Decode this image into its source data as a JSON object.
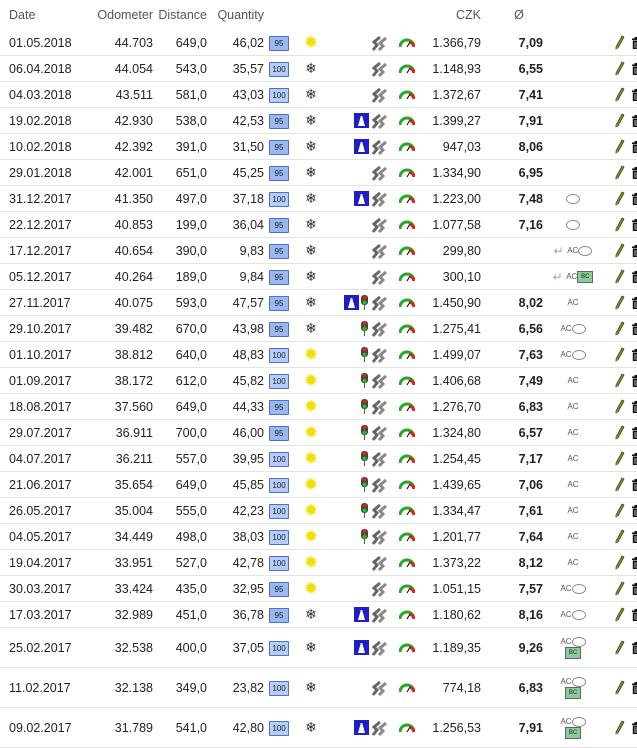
{
  "headers": {
    "date": "Date",
    "odometer": "Odometer",
    "distance": "Distance",
    "quantity": "Quantity",
    "czk": "CZK",
    "avg": "Ø"
  },
  "rows": [
    {
      "date": "01.05.2018",
      "odo": "44.703",
      "dist": "649,0",
      "qty": "46,02",
      "oct": "95",
      "season": "sun",
      "hw": false,
      "tl": false,
      "czk": "1.366,79",
      "avg": "7,09",
      "ac": false,
      "bubble": false,
      "bc": false,
      "ret": false
    },
    {
      "date": "06.04.2018",
      "odo": "44.054",
      "dist": "543,0",
      "qty": "35,57",
      "oct": "100",
      "season": "snow",
      "hw": false,
      "tl": false,
      "czk": "1.148,93",
      "avg": "6,55",
      "ac": false,
      "bubble": false,
      "bc": false,
      "ret": false
    },
    {
      "date": "04.03.2018",
      "odo": "43.511",
      "dist": "581,0",
      "qty": "43,03",
      "oct": "100",
      "season": "snow",
      "hw": false,
      "tl": false,
      "czk": "1.372,67",
      "avg": "7,41",
      "ac": false,
      "bubble": false,
      "bc": false,
      "ret": false
    },
    {
      "date": "19.02.2018",
      "odo": "42.930",
      "dist": "538,0",
      "qty": "42,53",
      "oct": "95",
      "season": "snow",
      "hw": true,
      "tl": false,
      "czk": "1.399,27",
      "avg": "7,91",
      "ac": false,
      "bubble": false,
      "bc": false,
      "ret": false
    },
    {
      "date": "10.02.2018",
      "odo": "42.392",
      "dist": "391,0",
      "qty": "31,50",
      "oct": "95",
      "season": "snow",
      "hw": true,
      "tl": false,
      "czk": "947,03",
      "avg": "8,06",
      "ac": false,
      "bubble": false,
      "bc": false,
      "ret": false
    },
    {
      "date": "29.01.2018",
      "odo": "42.001",
      "dist": "651,0",
      "qty": "45,25",
      "oct": "95",
      "season": "snow",
      "hw": false,
      "tl": false,
      "czk": "1.334,90",
      "avg": "6,95",
      "ac": false,
      "bubble": false,
      "bc": false,
      "ret": false
    },
    {
      "date": "31.12.2017",
      "odo": "41.350",
      "dist": "497,0",
      "qty": "37,18",
      "oct": "100",
      "season": "snow",
      "hw": true,
      "tl": false,
      "czk": "1.223,00",
      "avg": "7,48",
      "ac": false,
      "bubble": true,
      "bc": false,
      "ret": false
    },
    {
      "date": "22.12.2017",
      "odo": "40.853",
      "dist": "199,0",
      "qty": "36,04",
      "oct": "95",
      "season": "snow",
      "hw": false,
      "tl": false,
      "czk": "1.077,58",
      "avg": "7,16",
      "ac": false,
      "bubble": true,
      "bc": false,
      "ret": false
    },
    {
      "date": "17.12.2017",
      "odo": "40.654",
      "dist": "390,0",
      "qty": "9,83",
      "oct": "95",
      "season": "snow",
      "hw": false,
      "tl": false,
      "czk": "299,80",
      "avg": "",
      "ac": true,
      "bubble": true,
      "bc": false,
      "ret": true
    },
    {
      "date": "05.12.2017",
      "odo": "40.264",
      "dist": "189,0",
      "qty": "9,84",
      "oct": "95",
      "season": "snow",
      "hw": false,
      "tl": false,
      "czk": "300,10",
      "avg": "",
      "ac": true,
      "bubble": false,
      "bc": true,
      "ret": true
    },
    {
      "date": "27.11.2017",
      "odo": "40.075",
      "dist": "593,0",
      "qty": "47,57",
      "oct": "95",
      "season": "snow",
      "hw": true,
      "tl": true,
      "czk": "1.450,90",
      "avg": "8,02",
      "ac": true,
      "bubble": false,
      "bc": false,
      "ret": false
    },
    {
      "date": "29.10.2017",
      "odo": "39.482",
      "dist": "670,0",
      "qty": "43,98",
      "oct": "95",
      "season": "snow",
      "hw": false,
      "tl": true,
      "czk": "1.275,41",
      "avg": "6,56",
      "ac": true,
      "bubble": true,
      "bc": false,
      "ret": false
    },
    {
      "date": "01.10.2017",
      "odo": "38.812",
      "dist": "640,0",
      "qty": "48,83",
      "oct": "100",
      "season": "sun",
      "hw": false,
      "tl": true,
      "czk": "1.499,07",
      "avg": "7,63",
      "ac": true,
      "bubble": true,
      "bc": false,
      "ret": false
    },
    {
      "date": "01.09.2017",
      "odo": "38.172",
      "dist": "612,0",
      "qty": "45,82",
      "oct": "100",
      "season": "sun",
      "hw": false,
      "tl": true,
      "czk": "1.406,68",
      "avg": "7,49",
      "ac": true,
      "bubble": false,
      "bc": false,
      "ret": false
    },
    {
      "date": "18.08.2017",
      "odo": "37.560",
      "dist": "649,0",
      "qty": "44,33",
      "oct": "95",
      "season": "sun",
      "hw": false,
      "tl": true,
      "czk": "1.276,70",
      "avg": "6,83",
      "ac": true,
      "bubble": false,
      "bc": false,
      "ret": false
    },
    {
      "date": "29.07.2017",
      "odo": "36.911",
      "dist": "700,0",
      "qty": "46,00",
      "oct": "95",
      "season": "sun",
      "hw": false,
      "tl": true,
      "czk": "1.324,80",
      "avg": "6,57",
      "ac": true,
      "bubble": false,
      "bc": false,
      "ret": false
    },
    {
      "date": "04.07.2017",
      "odo": "36.211",
      "dist": "557,0",
      "qty": "39,95",
      "oct": "100",
      "season": "sun",
      "hw": false,
      "tl": true,
      "czk": "1.254,45",
      "avg": "7,17",
      "ac": true,
      "bubble": false,
      "bc": false,
      "ret": false
    },
    {
      "date": "21.06.2017",
      "odo": "35.654",
      "dist": "649,0",
      "qty": "45,85",
      "oct": "100",
      "season": "sun",
      "hw": false,
      "tl": true,
      "czk": "1.439,65",
      "avg": "7,06",
      "ac": true,
      "bubble": false,
      "bc": false,
      "ret": false
    },
    {
      "date": "26.05.2017",
      "odo": "35.004",
      "dist": "555,0",
      "qty": "42,23",
      "oct": "100",
      "season": "sun",
      "hw": false,
      "tl": true,
      "czk": "1.334,47",
      "avg": "7,61",
      "ac": true,
      "bubble": false,
      "bc": false,
      "ret": false
    },
    {
      "date": "04.05.2017",
      "odo": "34.449",
      "dist": "498,0",
      "qty": "38,03",
      "oct": "100",
      "season": "sun",
      "hw": false,
      "tl": true,
      "czk": "1.201,77",
      "avg": "7,64",
      "ac": true,
      "bubble": false,
      "bc": false,
      "ret": false
    },
    {
      "date": "19.04.2017",
      "odo": "33.951",
      "dist": "527,0",
      "qty": "42,78",
      "oct": "100",
      "season": "sun",
      "hw": false,
      "tl": false,
      "czk": "1.373,22",
      "avg": "8,12",
      "ac": true,
      "bubble": false,
      "bc": false,
      "ret": false
    },
    {
      "date": "30.03.2017",
      "odo": "33.424",
      "dist": "435,0",
      "qty": "32,95",
      "oct": "95",
      "season": "sun",
      "hw": false,
      "tl": false,
      "czk": "1.051,15",
      "avg": "7,57",
      "ac": true,
      "bubble": true,
      "bc": false,
      "ret": false
    },
    {
      "date": "17.03.2017",
      "odo": "32.989",
      "dist": "451,0",
      "qty": "36,78",
      "oct": "95",
      "season": "snow",
      "hw": true,
      "tl": false,
      "czk": "1.180,62",
      "avg": "8,16",
      "ac": true,
      "bubble": true,
      "bc": false,
      "ret": false
    },
    {
      "date": "25.02.2017",
      "odo": "32.538",
      "dist": "400,0",
      "qty": "37,05",
      "oct": "100",
      "season": "snow",
      "hw": true,
      "tl": false,
      "czk": "1.189,35",
      "avg": "9,26",
      "ac": true,
      "bubble": true,
      "bc": true,
      "ret": false,
      "tall": true
    },
    {
      "date": "11.02.2017",
      "odo": "32.138",
      "dist": "349,0",
      "qty": "23,82",
      "oct": "100",
      "season": "snow",
      "hw": false,
      "tl": false,
      "czk": "774,18",
      "avg": "6,83",
      "ac": true,
      "bubble": true,
      "bc": true,
      "ret": false,
      "tall": true
    },
    {
      "date": "09.02.2017",
      "odo": "31.789",
      "dist": "541,0",
      "qty": "42,80",
      "oct": "100",
      "season": "snow",
      "hw": true,
      "tl": false,
      "czk": "1.256,53",
      "avg": "7,91",
      "ac": true,
      "bubble": true,
      "bc": true,
      "ret": false,
      "tall": true
    }
  ],
  "labels": {
    "ac": "AC",
    "bc": "BC"
  },
  "colors": {
    "octane_bg": "#9db8f0",
    "octane_border": "#4a6fd0",
    "highway": "#1e1ec8",
    "sun": "#f0e000"
  }
}
